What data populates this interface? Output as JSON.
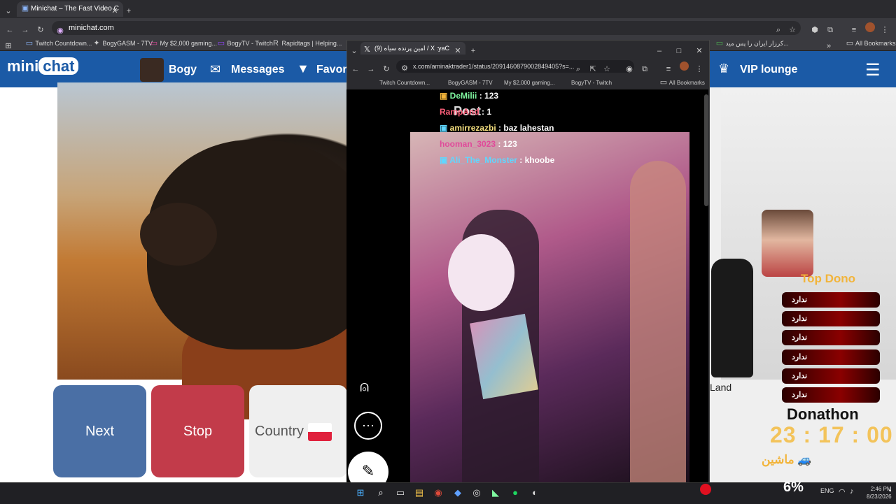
{
  "browser": {
    "tab_title": "Minichat – The Fast Video C",
    "url": "minichat.com",
    "bookmarks": [
      "Twitch Countdown...",
      "BogyGASM - 7TV",
      "My $2,000 gaming...",
      "BogyTV - Twitch",
      "Rapidtags | Helping...",
      "کرزار ایران را پس مید...",
      "All Bookmarks"
    ]
  },
  "minichat": {
    "logo_left": "mini",
    "logo_right": "chat",
    "nav_user": "Bogy",
    "nav_messages": "Messages",
    "nav_favorites": "Favor",
    "nav_vip": "VIP lounge",
    "btn_next": "Next",
    "btn_stop": "Stop",
    "btn_country": "Country"
  },
  "xwindow": {
    "tab_title": "(9) امین پرنده سیاه / X :yaC",
    "url": "x.com/aminaktrader1/status/2091460879002849405?s=...",
    "bookmarks": [
      "Twitch Countdown...",
      "BogyGASM - 7TV",
      "My $2,000 gaming...",
      "BogyTV - Twitch",
      "All Bookmarks"
    ],
    "post_title": "Post"
  },
  "chat": [
    {
      "user": "DeMilii",
      "msg": ": 123",
      "color": "#7ff7a0"
    },
    {
      "user": "RampAnd",
      "msg": ": 1",
      "color": "#ff5f7a"
    },
    {
      "user": "amirrezazbi",
      "msg": ": baz lahestan",
      "color": "#f7e27f"
    },
    {
      "user": "hooman_3023",
      "msg": ": 123",
      "color": "#e04a9a"
    },
    {
      "user": "Ali_The_Monster",
      "msg": ": khoobe",
      "color": "#5fd7ff"
    }
  ],
  "stream": {
    "top_dono_label": "Top Dono",
    "dono_rows": [
      "ندارد",
      "ندارد",
      "ندارد",
      "ندارد",
      "ندارد",
      "ندارد"
    ],
    "donathon_label": "Donathon",
    "timer": "23 : 17 : 00",
    "car_label": "ماشین",
    "land_text": "Land",
    "percent": "6%"
  },
  "taskbar": {
    "lang": "ENG",
    "time": "2:46 PM",
    "date": "8/23/2026"
  },
  "colors": {
    "minichat_header": "#1b5aa6",
    "next_button": "#4a6fa5",
    "stop_button": "#c23b4a",
    "top_dono": "#f2b43a"
  }
}
